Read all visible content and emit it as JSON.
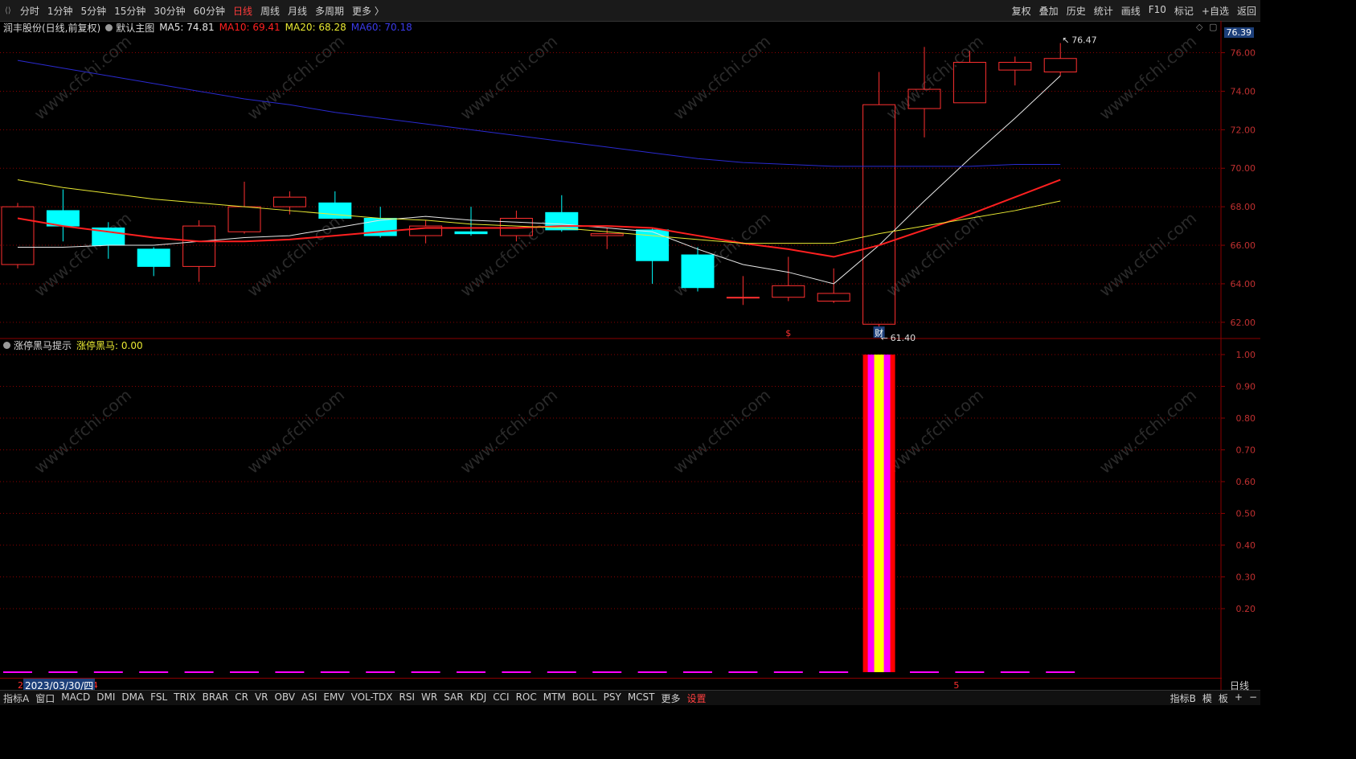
{
  "toolbar": {
    "left_items": [
      "分时",
      "1分钟",
      "5分钟",
      "15分钟",
      "30分钟",
      "60分钟",
      "日线",
      "周线",
      "月线",
      "多周期",
      "更多 〉"
    ],
    "active_item": "日线",
    "right_items": [
      "复权",
      "叠加",
      "历史",
      "统计",
      "画线",
      "F10",
      "标记",
      "+自选",
      "返回"
    ]
  },
  "main_info": {
    "stock": "润丰股份(日线,前复权)",
    "template": "默认主图",
    "ma5": "MA5: 74.81",
    "ma10": "MA10: 69.41",
    "ma20": "MA20: 68.28",
    "ma60": "MA60: 70.18",
    "last_price": "76.39"
  },
  "sub_info": {
    "indicator": "涨停黑马提示",
    "value": "涨停黑马: 0.00"
  },
  "colors": {
    "up": "#ff3030",
    "down": "#00ffff",
    "ma5": "#e8e8e8",
    "ma10": "#ff2020",
    "ma20": "#e8e832",
    "ma60": "#2a2ad0",
    "grid": "#8b0000",
    "bar_outer": "#ff0000",
    "bar_mid": "#ff00ff",
    "bar_core": "#ffff00"
  },
  "chart_data": [
    {
      "type": "candlestick",
      "title": "润丰股份(日线,前复权)",
      "yaxis_ticks": [
        "76.00",
        "74.00",
        "72.00",
        "70.00",
        "68.00",
        "66.00",
        "64.00",
        "62.00"
      ],
      "ylim": [
        61.2,
        76.9
      ],
      "candles": [
        {
          "o": 65.0,
          "h": 68.2,
          "l": 64.8,
          "c": 68.0
        },
        {
          "o": 67.8,
          "h": 68.9,
          "l": 66.2,
          "c": 67.0
        },
        {
          "o": 66.9,
          "h": 67.2,
          "l": 65.3,
          "c": 66.0
        },
        {
          "o": 65.8,
          "h": 65.9,
          "l": 64.4,
          "c": 64.9
        },
        {
          "o": 64.9,
          "h": 67.3,
          "l": 64.1,
          "c": 67.0
        },
        {
          "o": 66.7,
          "h": 69.3,
          "l": 66.6,
          "c": 68.0
        },
        {
          "o": 68.0,
          "h": 68.8,
          "l": 67.6,
          "c": 68.5
        },
        {
          "o": 68.2,
          "h": 68.8,
          "l": 67.4,
          "c": 67.4
        },
        {
          "o": 67.4,
          "h": 68.0,
          "l": 66.4,
          "c": 66.5
        },
        {
          "o": 66.5,
          "h": 67.3,
          "l": 66.1,
          "c": 67.0
        },
        {
          "o": 66.7,
          "h": 68.0,
          "l": 66.5,
          "c": 66.6
        },
        {
          "o": 66.5,
          "h": 67.8,
          "l": 66.2,
          "c": 67.4
        },
        {
          "o": 67.7,
          "h": 68.6,
          "l": 66.7,
          "c": 66.8
        },
        {
          "o": 66.5,
          "h": 66.9,
          "l": 65.8,
          "c": 66.6
        },
        {
          "o": 66.8,
          "h": 66.9,
          "l": 64.0,
          "c": 65.2
        },
        {
          "o": 65.5,
          "h": 65.9,
          "l": 63.6,
          "c": 63.8
        },
        {
          "o": 63.3,
          "h": 64.4,
          "l": 62.9,
          "c": 63.3
        },
        {
          "o": 63.3,
          "h": 65.4,
          "l": 63.1,
          "c": 63.9
        },
        {
          "o": 63.1,
          "h": 64.8,
          "l": 63.0,
          "c": 63.5
        },
        {
          "o": 61.9,
          "h": 75.0,
          "l": 61.4,
          "c": 73.3
        },
        {
          "o": 73.1,
          "h": 76.3,
          "l": 71.6,
          "c": 74.1
        },
        {
          "o": 73.4,
          "h": 76.1,
          "l": 73.4,
          "c": 75.5
        },
        {
          "o": 75.1,
          "h": 75.8,
          "l": 74.3,
          "c": 75.5
        },
        {
          "o": 75.0,
          "h": 76.5,
          "l": 74.8,
          "c": 75.7
        }
      ],
      "series": [
        {
          "name": "MA5",
          "values": [
            65.9,
            65.9,
            66.0,
            66.0,
            66.2,
            66.4,
            66.5,
            66.9,
            67.3,
            67.5,
            67.3,
            67.2,
            67.1,
            66.9,
            66.7,
            65.8,
            65.0,
            64.6,
            64.0,
            66.0,
            68.3,
            70.5,
            72.6,
            74.8
          ]
        },
        {
          "name": "MA10",
          "values": [
            67.4,
            67.0,
            66.7,
            66.4,
            66.2,
            66.2,
            66.3,
            66.5,
            66.7,
            66.9,
            66.9,
            66.9,
            67.0,
            67.0,
            66.9,
            66.5,
            66.1,
            65.8,
            65.4,
            66.0,
            66.8,
            67.6,
            68.5,
            69.4
          ]
        },
        {
          "name": "MA20",
          "values": [
            69.4,
            69.0,
            68.7,
            68.4,
            68.2,
            68.0,
            67.8,
            67.6,
            67.4,
            67.3,
            67.1,
            67.0,
            66.9,
            66.7,
            66.5,
            66.3,
            66.1,
            66.1,
            66.1,
            66.6,
            67.0,
            67.4,
            67.8,
            68.3
          ]
        },
        {
          "name": "MA60",
          "values": [
            75.6,
            75.2,
            74.8,
            74.4,
            74.0,
            73.6,
            73.3,
            72.9,
            72.6,
            72.3,
            72.0,
            71.7,
            71.4,
            71.1,
            70.8,
            70.5,
            70.3,
            70.2,
            70.1,
            70.1,
            70.1,
            70.1,
            70.2,
            70.2
          ]
        }
      ],
      "annotations": [
        {
          "candle": 23,
          "value": 76.47,
          "text": "76.47"
        },
        {
          "candle": 19,
          "value": 61.4,
          "text": "61.40"
        }
      ],
      "markers": [
        {
          "candle": 17,
          "text": "$"
        },
        {
          "candle": 19,
          "text": "财"
        }
      ]
    },
    {
      "type": "bar",
      "title": "涨停黑马提示",
      "series": [
        {
          "name": "涨停黑马",
          "values": [
            0,
            0,
            0,
            0,
            0,
            0,
            0,
            0,
            0,
            0,
            0,
            0,
            0,
            0,
            0,
            0,
            0,
            0,
            0,
            1,
            0,
            0,
            0,
            0
          ]
        }
      ],
      "yaxis_ticks": [
        "1.00",
        "0.90",
        "0.80",
        "0.70",
        "0.60",
        "0.50",
        "0.40",
        "0.30",
        "0.20"
      ],
      "ylim": [
        0,
        1.0
      ]
    }
  ],
  "xaxis": {
    "cursor_date": "2023/03/30/四",
    "labels": [
      {
        "candle": 0,
        "text": "2"
      },
      {
        "candle": 2,
        "text": "4"
      },
      {
        "candle": 21,
        "text": "5"
      }
    ]
  },
  "bottom_bar": {
    "items": [
      "指标A",
      "窗口",
      "MACD",
      "DMI",
      "DMA",
      "FSL",
      "TRIX",
      "BRAR",
      "CR",
      "VR",
      "OBV",
      "ASI",
      "EMV",
      "VOL-TDX",
      "RSI",
      "WR",
      "SAR",
      "KDJ",
      "CCI",
      "ROC",
      "MTM",
      "BOLL",
      "PSY",
      "MCST",
      "更多",
      "设置"
    ],
    "active_item": "设置",
    "right_items": [
      "指标B",
      "模",
      "板",
      "+",
      "−"
    ],
    "period": "日线"
  },
  "watermark": "www.cfchi.com"
}
